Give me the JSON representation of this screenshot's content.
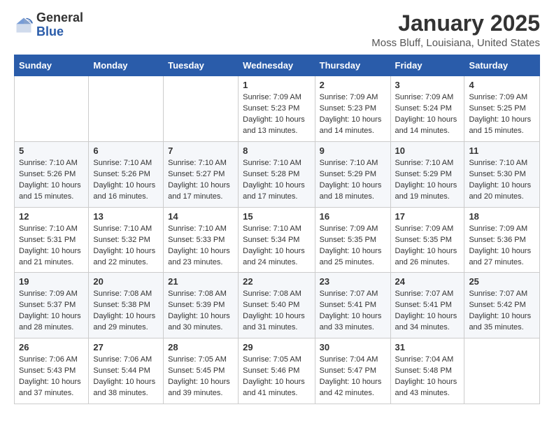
{
  "header": {
    "logo_general": "General",
    "logo_blue": "Blue",
    "month_title": "January 2025",
    "location": "Moss Bluff, Louisiana, United States"
  },
  "days_of_week": [
    "Sunday",
    "Monday",
    "Tuesday",
    "Wednesday",
    "Thursday",
    "Friday",
    "Saturday"
  ],
  "weeks": [
    [
      {
        "day": "",
        "info": ""
      },
      {
        "day": "",
        "info": ""
      },
      {
        "day": "",
        "info": ""
      },
      {
        "day": "1",
        "info": "Sunrise: 7:09 AM\nSunset: 5:23 PM\nDaylight: 10 hours\nand 13 minutes."
      },
      {
        "day": "2",
        "info": "Sunrise: 7:09 AM\nSunset: 5:23 PM\nDaylight: 10 hours\nand 14 minutes."
      },
      {
        "day": "3",
        "info": "Sunrise: 7:09 AM\nSunset: 5:24 PM\nDaylight: 10 hours\nand 14 minutes."
      },
      {
        "day": "4",
        "info": "Sunrise: 7:09 AM\nSunset: 5:25 PM\nDaylight: 10 hours\nand 15 minutes."
      }
    ],
    [
      {
        "day": "5",
        "info": "Sunrise: 7:10 AM\nSunset: 5:26 PM\nDaylight: 10 hours\nand 15 minutes."
      },
      {
        "day": "6",
        "info": "Sunrise: 7:10 AM\nSunset: 5:26 PM\nDaylight: 10 hours\nand 16 minutes."
      },
      {
        "day": "7",
        "info": "Sunrise: 7:10 AM\nSunset: 5:27 PM\nDaylight: 10 hours\nand 17 minutes."
      },
      {
        "day": "8",
        "info": "Sunrise: 7:10 AM\nSunset: 5:28 PM\nDaylight: 10 hours\nand 17 minutes."
      },
      {
        "day": "9",
        "info": "Sunrise: 7:10 AM\nSunset: 5:29 PM\nDaylight: 10 hours\nand 18 minutes."
      },
      {
        "day": "10",
        "info": "Sunrise: 7:10 AM\nSunset: 5:29 PM\nDaylight: 10 hours\nand 19 minutes."
      },
      {
        "day": "11",
        "info": "Sunrise: 7:10 AM\nSunset: 5:30 PM\nDaylight: 10 hours\nand 20 minutes."
      }
    ],
    [
      {
        "day": "12",
        "info": "Sunrise: 7:10 AM\nSunset: 5:31 PM\nDaylight: 10 hours\nand 21 minutes."
      },
      {
        "day": "13",
        "info": "Sunrise: 7:10 AM\nSunset: 5:32 PM\nDaylight: 10 hours\nand 22 minutes."
      },
      {
        "day": "14",
        "info": "Sunrise: 7:10 AM\nSunset: 5:33 PM\nDaylight: 10 hours\nand 23 minutes."
      },
      {
        "day": "15",
        "info": "Sunrise: 7:10 AM\nSunset: 5:34 PM\nDaylight: 10 hours\nand 24 minutes."
      },
      {
        "day": "16",
        "info": "Sunrise: 7:09 AM\nSunset: 5:35 PM\nDaylight: 10 hours\nand 25 minutes."
      },
      {
        "day": "17",
        "info": "Sunrise: 7:09 AM\nSunset: 5:35 PM\nDaylight: 10 hours\nand 26 minutes."
      },
      {
        "day": "18",
        "info": "Sunrise: 7:09 AM\nSunset: 5:36 PM\nDaylight: 10 hours\nand 27 minutes."
      }
    ],
    [
      {
        "day": "19",
        "info": "Sunrise: 7:09 AM\nSunset: 5:37 PM\nDaylight: 10 hours\nand 28 minutes."
      },
      {
        "day": "20",
        "info": "Sunrise: 7:08 AM\nSunset: 5:38 PM\nDaylight: 10 hours\nand 29 minutes."
      },
      {
        "day": "21",
        "info": "Sunrise: 7:08 AM\nSunset: 5:39 PM\nDaylight: 10 hours\nand 30 minutes."
      },
      {
        "day": "22",
        "info": "Sunrise: 7:08 AM\nSunset: 5:40 PM\nDaylight: 10 hours\nand 31 minutes."
      },
      {
        "day": "23",
        "info": "Sunrise: 7:07 AM\nSunset: 5:41 PM\nDaylight: 10 hours\nand 33 minutes."
      },
      {
        "day": "24",
        "info": "Sunrise: 7:07 AM\nSunset: 5:41 PM\nDaylight: 10 hours\nand 34 minutes."
      },
      {
        "day": "25",
        "info": "Sunrise: 7:07 AM\nSunset: 5:42 PM\nDaylight: 10 hours\nand 35 minutes."
      }
    ],
    [
      {
        "day": "26",
        "info": "Sunrise: 7:06 AM\nSunset: 5:43 PM\nDaylight: 10 hours\nand 37 minutes."
      },
      {
        "day": "27",
        "info": "Sunrise: 7:06 AM\nSunset: 5:44 PM\nDaylight: 10 hours\nand 38 minutes."
      },
      {
        "day": "28",
        "info": "Sunrise: 7:05 AM\nSunset: 5:45 PM\nDaylight: 10 hours\nand 39 minutes."
      },
      {
        "day": "29",
        "info": "Sunrise: 7:05 AM\nSunset: 5:46 PM\nDaylight: 10 hours\nand 41 minutes."
      },
      {
        "day": "30",
        "info": "Sunrise: 7:04 AM\nSunset: 5:47 PM\nDaylight: 10 hours\nand 42 minutes."
      },
      {
        "day": "31",
        "info": "Sunrise: 7:04 AM\nSunset: 5:48 PM\nDaylight: 10 hours\nand 43 minutes."
      },
      {
        "day": "",
        "info": ""
      }
    ]
  ]
}
